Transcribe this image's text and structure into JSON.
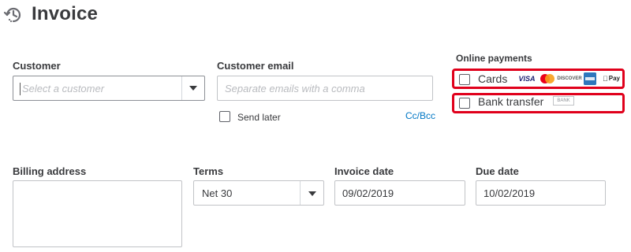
{
  "header": {
    "title": "Invoice",
    "icon": "recurring-clock-icon"
  },
  "customer": {
    "label": "Customer",
    "placeholder": "Select a customer"
  },
  "customer_email": {
    "label": "Customer email",
    "placeholder": "Separate emails with a comma"
  },
  "send_later": {
    "label": "Send later",
    "checked": false
  },
  "cc_bcc": {
    "label": "Cc/Bcc"
  },
  "online_payments": {
    "label": "Online payments",
    "cards": {
      "label": "Cards",
      "checked": false,
      "brands": {
        "visa": "VISA",
        "mastercard": "MasterCard",
        "discover": "DISCOVER",
        "amex": "AMERICAN EXPRESS",
        "applepay": "Pay"
      }
    },
    "bank_transfer": {
      "label": "Bank transfer",
      "checked": false,
      "badge": "BANK"
    },
    "highlight_color": "#e0001b"
  },
  "billing_address": {
    "label": "Billing address",
    "value": ""
  },
  "terms": {
    "label": "Terms",
    "value": "Net 30"
  },
  "invoice_date": {
    "label": "Invoice date",
    "value": "09/02/2019"
  },
  "due_date": {
    "label": "Due date",
    "value": "10/02/2019"
  },
  "colors": {
    "link": "#0077c5",
    "text": "#393a3d",
    "border": "#c1c3c7"
  }
}
